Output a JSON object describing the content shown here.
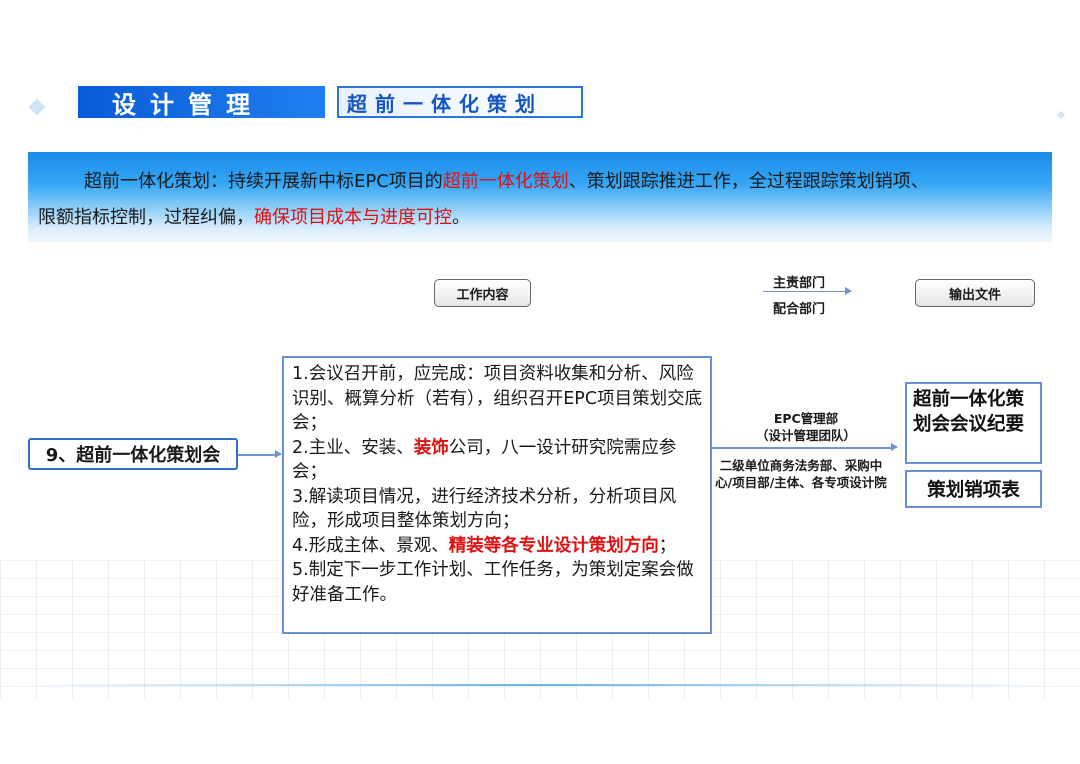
{
  "header": {
    "title": "设计管理",
    "subtitle": "超前一体化策划"
  },
  "banner": {
    "p1": "超前一体化策划：持续开展新中标EPC项目的",
    "p1_red": "超前一体化策划",
    "p2": "、策划跟踪推进工作，全过程跟踪策划销项、",
    "p3": "限额指标控制，过程纠偏，",
    "p3_red": "确保项目成本与进度可控",
    "p4": "。"
  },
  "legend": {
    "work_content": "工作内容",
    "lead_dept": "主责部门",
    "support_dept": "配合部门",
    "output": "输出文件"
  },
  "item": {
    "label": "9、超前一体化策划会"
  },
  "content": {
    "l1": "1.会议召开前，应完成：项目资料收集和分析、风险识别、概算分析（若有），组织召开EPC项目策划交底会；",
    "l2a": "2.主业、安装、",
    "l2b": "装饰",
    "l2c": "公司，八一设计研究院需应参会；",
    "l3": "3.解读项目情况，进行经济技术分析，分析项目风险，形成项目整体策划方向；",
    "l4a": "4.形成主体、景观、",
    "l4b": "精装等各专业设计策划方向",
    "l4c": "；",
    "l5": "5.制定下一步工作计划、工作任务，为策划定案会做好准备工作。"
  },
  "departments": {
    "lead_l1": "EPC管理部",
    "lead_l2": "（设计管理团队）",
    "support": "二级单位商务法务部、采购中心/项目部/主体、各专项设计院"
  },
  "outputs": {
    "doc1": "超前一体化策划会会议纪要",
    "doc2": "策划销项表"
  },
  "colors": {
    "accent_blue": "#1f7ff0",
    "highlight_red": "#e01010"
  }
}
